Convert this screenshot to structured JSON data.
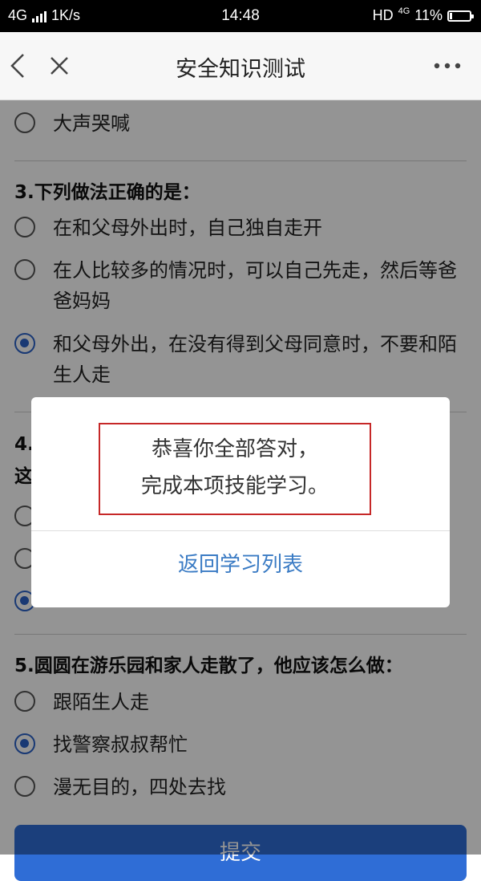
{
  "status_bar": {
    "network": "4G",
    "speed": "1K/s",
    "time": "14:48",
    "hd": "HD",
    "network_right": "4G",
    "battery": "11%"
  },
  "nav": {
    "title": "安全知识测试",
    "back_icon": "back-chevron-icon",
    "close_icon": "close-icon",
    "more_icon": "more-dots-icon"
  },
  "questions": [
    {
      "title": "",
      "options": [
        {
          "text": "大声哭喊",
          "selected": false
        }
      ]
    },
    {
      "title": "3.下列做法正确的是：",
      "options": [
        {
          "text": "在和父母外出时，自己独自走开",
          "selected": false
        },
        {
          "text": "在人比较多的情况时，可以自己先走，然后等爸爸妈妈",
          "selected": false
        },
        {
          "text": "和父母外出，在没有得到父母同意时，不要和陌生人走",
          "selected": true
        }
      ]
    },
    {
      "title": "4.",
      "title_line2": "这",
      "options": []
    },
    {
      "title": "5.圆圆在游乐园和家人走散了，他应该怎么做：",
      "options": [
        {
          "text": "跟陌生人走",
          "selected": false
        },
        {
          "text": "找警察叔叔帮忙",
          "selected": true
        },
        {
          "text": "漫无目的，四处去找",
          "selected": false
        }
      ]
    }
  ],
  "submit_label": "提交",
  "dialog": {
    "message_line1": "恭喜你全部答对，",
    "message_line2": "完成本项技能学习。",
    "button_label": "返回学习列表"
  },
  "colors": {
    "accent": "#2b63c9",
    "submit": "#2f6dd6",
    "dialog_link": "#3a7bc4",
    "highlight_border": "#c62828"
  }
}
